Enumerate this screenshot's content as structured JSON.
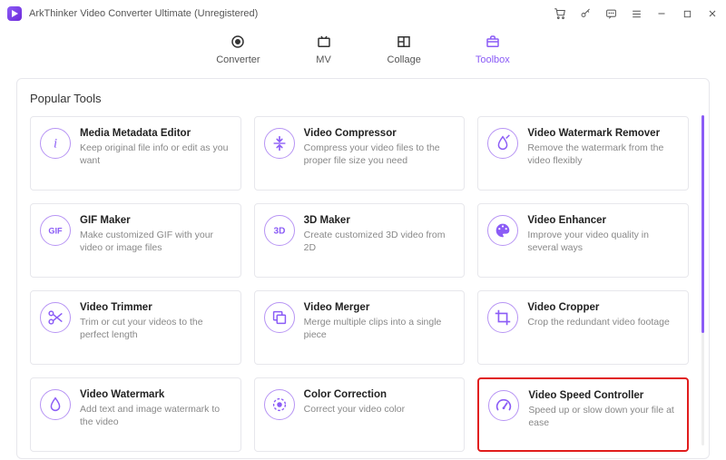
{
  "window": {
    "title": "ArkThinker Video Converter Ultimate (Unregistered)"
  },
  "tabs": {
    "converter": "Converter",
    "mv": "MV",
    "collage": "Collage",
    "toolbox": "Toolbox"
  },
  "section_title": "Popular Tools",
  "tools": [
    {
      "title": "Media Metadata Editor",
      "desc": "Keep original file info or edit as you want",
      "icon": "info-icon"
    },
    {
      "title": "Video Compressor",
      "desc": "Compress your video files to the proper file size you need",
      "icon": "compress-icon"
    },
    {
      "title": "Video Watermark Remover",
      "desc": "Remove the watermark from the video flexibly",
      "icon": "drop-remove-icon"
    },
    {
      "title": "GIF Maker",
      "desc": "Make customized GIF with your video or image files",
      "icon": "gif-icon"
    },
    {
      "title": "3D Maker",
      "desc": "Create customized 3D video from 2D",
      "icon": "3d-icon"
    },
    {
      "title": "Video Enhancer",
      "desc": "Improve your video quality in several ways",
      "icon": "palette-icon"
    },
    {
      "title": "Video Trimmer",
      "desc": "Trim or cut your videos to the perfect length",
      "icon": "scissors-icon"
    },
    {
      "title": "Video Merger",
      "desc": "Merge multiple clips into a single piece",
      "icon": "merge-icon"
    },
    {
      "title": "Video Cropper",
      "desc": "Crop the redundant video footage",
      "icon": "crop-icon"
    },
    {
      "title": "Video Watermark",
      "desc": "Add text and image watermark to the video",
      "icon": "drop-icon"
    },
    {
      "title": "Color Correction",
      "desc": "Correct your video color",
      "icon": "color-icon"
    },
    {
      "title": "Video Speed Controller",
      "desc": "Speed up or slow down your file at ease",
      "icon": "gauge-icon",
      "highlight": true
    }
  ]
}
